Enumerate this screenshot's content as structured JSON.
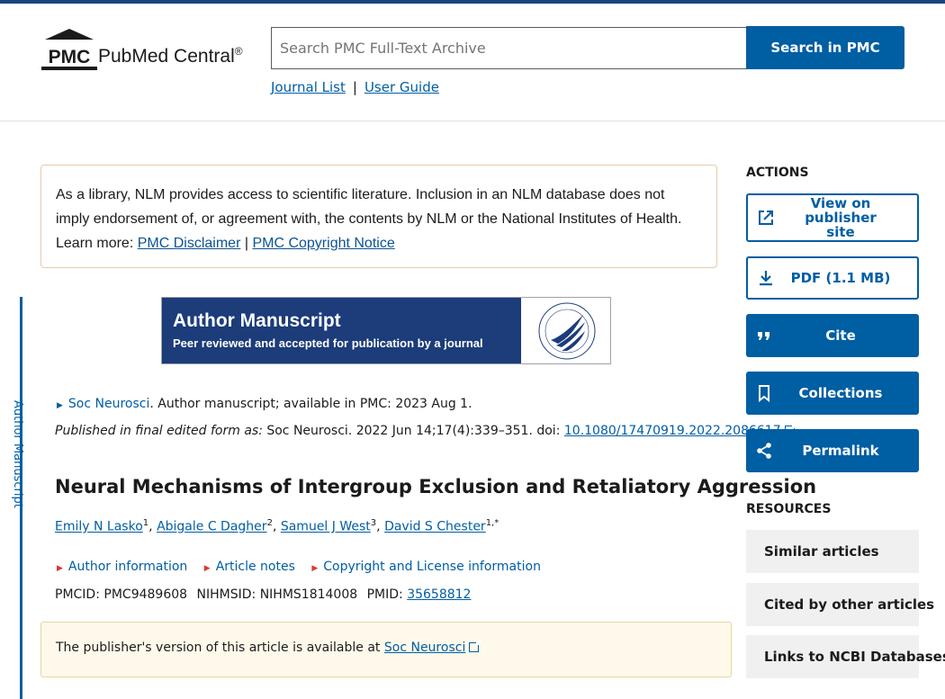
{
  "header": {
    "logo_mark": "PMC",
    "logo_name": "PubMed Central",
    "logo_reg": "®",
    "search_placeholder": "Search PMC Full-Text Archive",
    "search_button": "Search in PMC",
    "journal_list": "Journal List",
    "separator": "|",
    "user_guide": "User Guide"
  },
  "disclaimer": {
    "text": "As a library, NLM provides access to scientific literature. Inclusion in an NLM database does not imply endorsement of, or agreement with, the contents by NLM or the National Institutes of Health.",
    "learn_more": "Learn more:",
    "link1": "PMC Disclaimer",
    "sep": "|",
    "link2": "PMC Copyright Notice"
  },
  "side_label": "Author Manuscript",
  "banner": {
    "title": "Author Manuscript",
    "subtitle": "Peer reviewed and accepted for publication by a journal",
    "seal_text": "DEPARTMENT OF HEALTH & HUMAN SERVICES USA"
  },
  "article": {
    "journal": "Soc Neurosci",
    "journal_rest": ". Author manuscript; available in PMC: 2023 Aug 1.",
    "published_label": "Published in final edited form as:",
    "published_rest": "Soc Neurosci. 2022 Jun 14;17(4):339–351. doi:",
    "doi": "10.1080/17470919.2022.2086617",
    "title": "Neural Mechanisms of Intergroup Exclusion and Retaliatory Aggression",
    "authors": [
      {
        "name": "Emily N Lasko",
        "sup": "1"
      },
      {
        "name": "Abigale C Dagher",
        "sup": "2"
      },
      {
        "name": "Samuel J West",
        "sup": "3"
      },
      {
        "name": "David S Chester",
        "sup": "1,*"
      }
    ],
    "info_links": [
      "Author information",
      "Article notes",
      "Copyright and License information"
    ],
    "pmcid_label": "PMCID:",
    "pmcid": "PMC9489608",
    "nihmsid_label": "NIHMSID:",
    "nihmsid": "NIHMS1814008",
    "pmid_label": "PMID:",
    "pmid": "35658812",
    "pubver_text": "The publisher's version of this article is available at",
    "pubver_link": "Soc Neurosci"
  },
  "actions": {
    "heading": "ACTIONS",
    "view_publisher": "View on publisher site",
    "pdf": "PDF (1.1 MB)",
    "cite": "Cite",
    "collections": "Collections",
    "permalink": "Permalink"
  },
  "resources": {
    "heading": "RESOURCES",
    "items": [
      "Similar articles",
      "Cited by other articles",
      "Links to NCBI Databases"
    ]
  },
  "colors": {
    "primary": "#005ea2",
    "banner": "#1c3c7a",
    "topbar": "#1a4480",
    "notice_bg": "#fef9ea"
  }
}
